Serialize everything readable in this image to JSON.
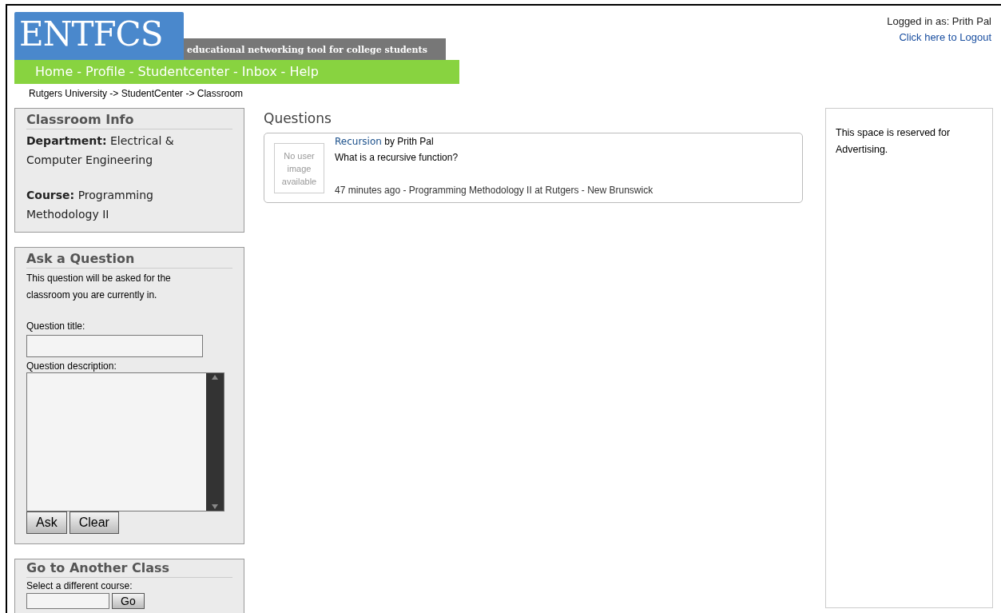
{
  "logo": {
    "title": "ENTFCS",
    "tagline": "educational networking tool for college students"
  },
  "nav": {
    "separator": "-",
    "items": [
      "Home",
      "Profile",
      "Studentcenter",
      "Inbox",
      "Help"
    ]
  },
  "account": {
    "logged_in": "Logged in as: Prith Pal",
    "logout": "Click here to Logout"
  },
  "breadcrumb": "Rutgers University -> StudentCenter -> Classroom",
  "classroom_info": {
    "title": "Classroom Info",
    "fields": [
      "**Department:** Electrical & Computer Engineering",
      "**Course:** Programming Methodology II"
    ]
  },
  "ask": {
    "title": "Ask a Question",
    "note": "This question will be asked for the classroom you are currently in.",
    "title_label": "Question title:",
    "description_label": "Question description:",
    "buttons": [
      "Ask",
      "Clear"
    ]
  },
  "other_class": {
    "title": "Go to Another Class",
    "label": "Select a different course:",
    "button": "Go"
  },
  "questions": {
    "title": "Questions",
    "items": [
      {
        "avatar_text": "No user image available",
        "title": "Recursion",
        "author": "by Prith Pal",
        "body": "What is a recursive function?",
        "meta": "47 minutes ago - Programming Methodology II at Rutgers - New Brunswick"
      }
    ]
  },
  "ad": "This space is reserved for Advertising."
}
